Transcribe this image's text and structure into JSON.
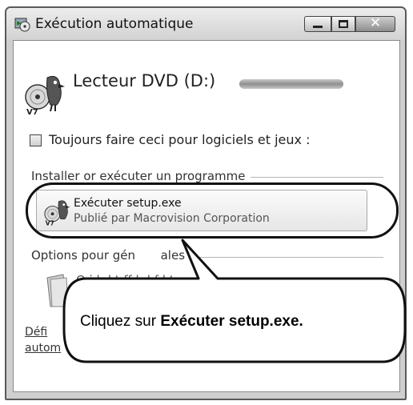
{
  "window": {
    "title": "Exécution automatique",
    "drive_name": "Lecteur DVD (D:)",
    "checkbox_label": "Toujours faire ceci pour logiciels et jeux :",
    "checkbox_checked": false
  },
  "section_install": {
    "heading": "Installer or exécuter un programme",
    "option_title": "Exécuter setup.exe",
    "option_subtitle": "Publié par Macrovision Corporation"
  },
  "section_general": {
    "heading": "Options pour gén",
    "heading_end": "ales",
    "folder_text": "O        i   l d         t ff·l   d   f·l t"
  },
  "links": {
    "line1": "Défi",
    "line2": "autom"
  },
  "icon_badge": "V7",
  "callout": {
    "prefix": "Cliquez sur ",
    "bold": "Exécuter setup.exe."
  }
}
